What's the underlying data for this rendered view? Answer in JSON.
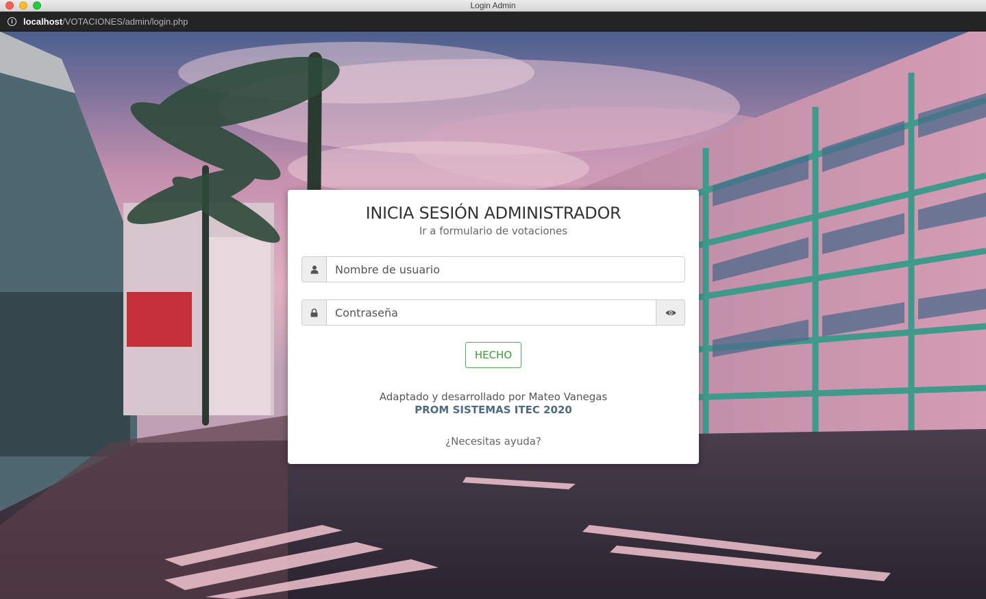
{
  "window": {
    "title": "Login Admin"
  },
  "address_bar": {
    "host": "localhost",
    "path": "/VOTACIONES/admin/login.php"
  },
  "login": {
    "title": "INICIA SESIÓN ADMINISTRADOR",
    "subtitle_link": "Ir a formulario de votaciones",
    "username": {
      "placeholder": "Nombre de usuario",
      "value": "",
      "icon": "user-icon"
    },
    "password": {
      "placeholder": "Contraseña",
      "value": "",
      "icon": "lock-icon",
      "toggle_icon": "eye-icon"
    },
    "submit_label": "HECHO",
    "credit_line": "Adaptado y desarrollado por Mateo Vanegas",
    "credit_org": "PROM SISTEMAS ITEC 2020",
    "help_link": "¿Necesitas ayuda?"
  },
  "colors": {
    "card_background": "#ffffff",
    "submit_border": "#4cae4c",
    "submit_text": "#3d9a3d",
    "org_text": "#4f6a80"
  }
}
